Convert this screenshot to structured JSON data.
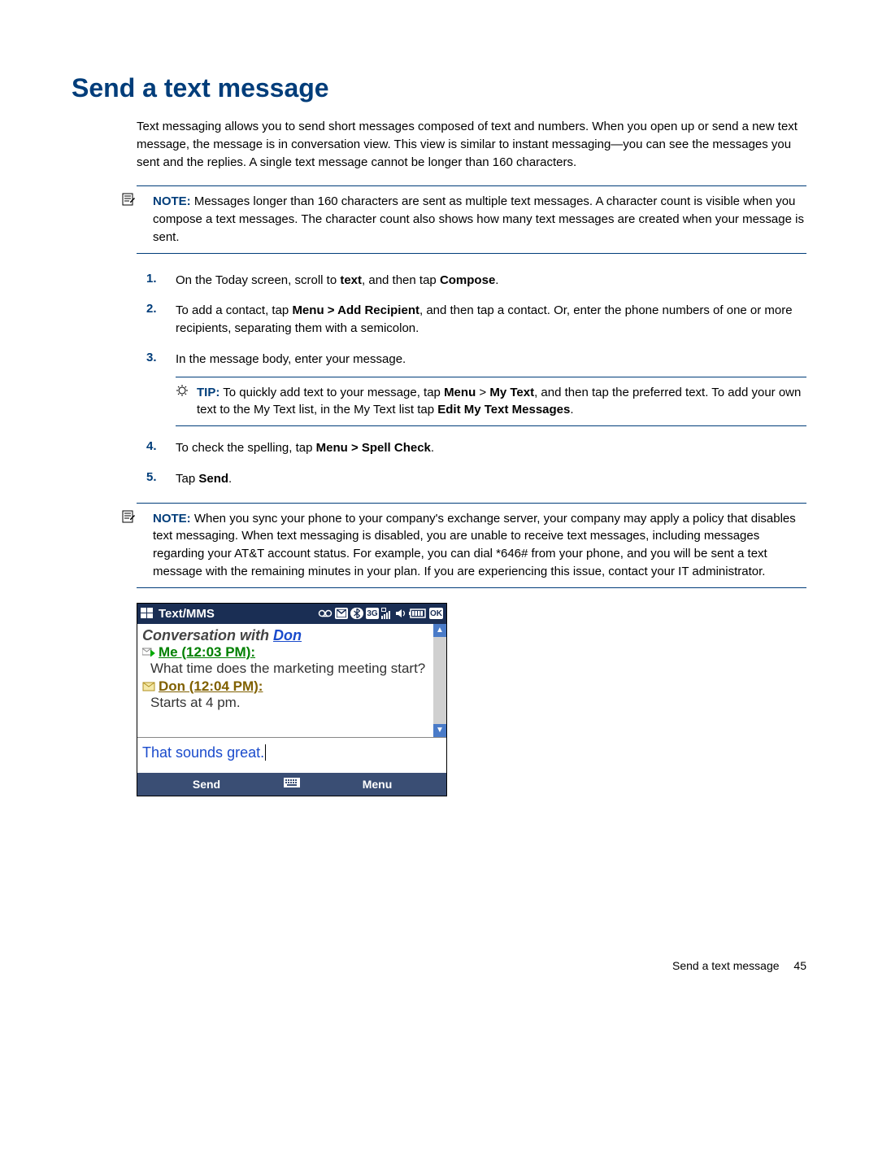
{
  "heading": "Send a text message",
  "intro": "Text messaging allows you to send short messages composed of text and numbers. When you open up or send a new text message, the message is in conversation view. This view is similar to instant messaging—you can see the messages you sent and the replies. A single text message cannot be longer than 160 characters.",
  "note1": {
    "label": "NOTE:",
    "text": "Messages longer than 160 characters are sent as multiple text messages. A character count is visible when you compose a text messages. The character count also shows how many text messages are created when your message is sent."
  },
  "steps": [
    {
      "num": "1.",
      "pre": "On the Today screen, scroll to ",
      "b1": "text",
      "mid": ", and then tap ",
      "b2": "Compose",
      "post": "."
    },
    {
      "num": "2.",
      "pre": "To add a contact, tap ",
      "b1": "Menu > Add Recipient",
      "mid": ", and then tap a contact. Or, enter the phone numbers of one or more recipients, separating them with a semicolon.",
      "b2": "",
      "post": ""
    },
    {
      "num": "3.",
      "pre": "In the message body, enter your message.",
      "b1": "",
      "mid": "",
      "b2": "",
      "post": ""
    },
    {
      "num": "4.",
      "pre": "To check the spelling, tap ",
      "b1": "Menu > Spell Check",
      "mid": ".",
      "b2": "",
      "post": ""
    },
    {
      "num": "5.",
      "pre": "Tap ",
      "b1": "Send",
      "mid": ".",
      "b2": "",
      "post": ""
    }
  ],
  "tip": {
    "label": "TIP:",
    "t1": "To quickly add text to your message, tap ",
    "b1": "Menu",
    "t2": " > ",
    "b2": "My Text",
    "t3": ", and then tap the preferred text. To add your own text to the My Text list, in the My Text list tap ",
    "b3": "Edit My Text Messages",
    "t4": "."
  },
  "note2": {
    "label": "NOTE:",
    "text": "When you sync your phone to your company's exchange server, your company may apply a policy that disables text messaging. When text messaging is disabled, you are unable to receive text messages, including messages regarding your AT&T account status. For example, you can dial *646# from your phone, and you will be sent a text message with the remaining minutes in your plan. If you are experiencing this issue, contact your IT administrator."
  },
  "screenshot": {
    "title": "Text/MMS",
    "status": {
      "net": "3G",
      "ok": "OK"
    },
    "conv_prefix": "Conversation with ",
    "conv_name": "Don",
    "msg1": {
      "sender": "Me (12:03 PM):",
      "text": "What time does the marketing meeting start?"
    },
    "msg2": {
      "sender": "Don (12:04 PM):",
      "text": "Starts at 4 pm."
    },
    "input": "That sounds great.",
    "softkeys": {
      "left": "Send",
      "right": "Menu"
    }
  },
  "footer": {
    "label": "Send a text message",
    "page": "45"
  }
}
